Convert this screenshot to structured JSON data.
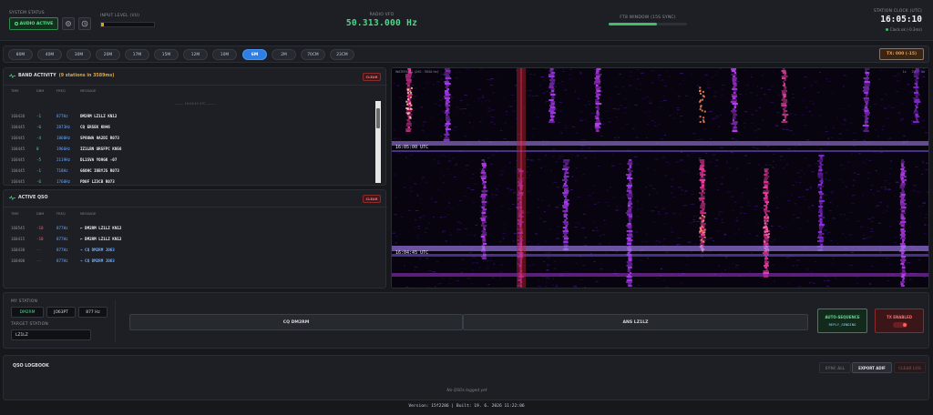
{
  "header": {
    "system_status_label": "SYSTEM STATUS",
    "audio_button": "AUDIO ACTIVE",
    "input_level_label": "INPUT LEVEL (VU)",
    "input_level_fraction": 0.05,
    "radio_vfo_label": "RADIO VFO",
    "radio_vfo": "50.313.000 Hz",
    "ft8_window_label": "FT8 WINDOW (15S SYNC)",
    "ft8_window_fraction": 0.62,
    "station_clock_label": "STATION CLOCK (UTC)",
    "station_clock": "16:05:10",
    "clock_status": "Clock ok (-0.3ms)"
  },
  "bands": [
    "80M",
    "40M",
    "30M",
    "20M",
    "17M",
    "15M",
    "12M",
    "10M",
    "6M",
    "2M",
    "70CM",
    "23CM"
  ],
  "active_band": "6M",
  "tx_badge": "TX: 000 (-15)",
  "band_activity": {
    "title": "BAND ACTIVITY",
    "count": "(9 stations in 3589ms)",
    "clear": "CLEAR",
    "headers": [
      "TIME",
      "DBM",
      "FREQ",
      "MESSAGE"
    ],
    "separator": "——— 16:04:45 UTC ———",
    "rows": [
      {
        "time": "160430",
        "db": "-1",
        "freq": "877Hz",
        "msg": "DM2RM LZ1LZ KN12"
      },
      {
        "time": "160445",
        "db": "-6",
        "freq": "2873Hz",
        "msg": "CQ ER5EK KN46"
      },
      {
        "time": "160445",
        "db": "-4",
        "freq": "1860Hz",
        "msg": "SP6OWA 9A2DI R073"
      },
      {
        "time": "160445",
        "db": "0",
        "freq": "1966Hz",
        "msg": "IZ1LBN UR5FPC KN56"
      },
      {
        "time": "160445",
        "db": "-5",
        "freq": "2119Hz",
        "msg": "DL1SVA YO9GK -07"
      },
      {
        "time": "160445",
        "db": "-1",
        "freq": "718Hz",
        "msg": "G6OHC I6BYJS R073"
      },
      {
        "time": "160445",
        "db": "-6",
        "freq": "1760Hz",
        "msg": "PD0F LZ3CB R073"
      }
    ]
  },
  "active_qso": {
    "title": "ACTIVE QSO",
    "clear": "CLEAR",
    "headers": [
      "TIME",
      "DBM",
      "FREQ",
      "MESSAGE"
    ],
    "rows": [
      {
        "time": "160545",
        "db": "-10",
        "freq": "877Hz",
        "msg": "← DM2RM LZ1LZ KN12",
        "kind": "rx"
      },
      {
        "time": "160415",
        "db": "-10",
        "freq": "877Hz",
        "msg": "← DM2RM LZ1LZ KN12",
        "kind": "rx"
      },
      {
        "time": "160430",
        "db": "--",
        "freq": "877Hz",
        "msg": "→ CQ DM2RM JO63",
        "kind": "tx"
      },
      {
        "time": "160400",
        "db": "--",
        "freq": "877Hz",
        "msg": "→ CQ DM2RM JO63",
        "kind": "tx"
      }
    ]
  },
  "waterfall": {
    "title": "WATERFALL (200 - 3000 Hz)",
    "controls": [
      "1x",
      "2x",
      "4x"
    ],
    "timestamps": [
      "16:05:00 UTC",
      "16:04:45 UTC"
    ]
  },
  "station": {
    "my_station_label": "MY STATION",
    "callsign": "DM2RM",
    "locator": "JO63PT",
    "offset": "877 Hz",
    "target_label": "TARGET STATION",
    "target": "LZ1LZ",
    "cq_button": "CQ DM2RM",
    "ans_button": "ANS LZ1LZ",
    "auto_seq_label": "AUTO-SEQUENCE",
    "auto_seq_state": "REPLY_SENDING",
    "tx_enabled_label": "TX ENABLED"
  },
  "logbook": {
    "title": "QSO LOGBOOK",
    "sync": "SYNC ALL",
    "export": "EXPORT ADIF",
    "clear": "CLEAR LOG",
    "empty": "No QSOs logged yet"
  },
  "footer": "Version: 15f2286 | Built: 19. 6. 2026 11:22:06",
  "colors": {
    "accent": "#2d7fe6",
    "green": "#4cd98a",
    "red": "#ff5e5e",
    "orange": "#f09a4a"
  }
}
